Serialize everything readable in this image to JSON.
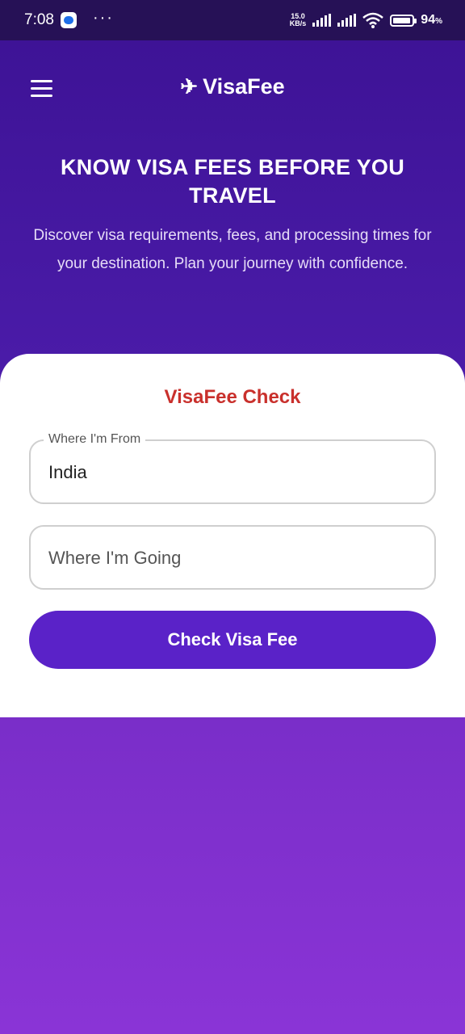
{
  "status_bar": {
    "time": "7:08",
    "more": "···",
    "net_speed_value": "15.0",
    "net_speed_unit": "KB/s",
    "battery_percent": "94",
    "battery_percent_sign": "%",
    "battery_level": 0.94
  },
  "appbar": {
    "brand_icon": "✈",
    "brand_name": "VisaFee"
  },
  "hero": {
    "title": "KNOW VISA FEES BEFORE YOU TRAVEL",
    "subtitle": "Discover visa requirements, fees, and processing times for your destination. Plan your journey with confidence."
  },
  "form": {
    "title": "VisaFee Check",
    "from_label": "Where I'm From",
    "from_value": "India",
    "to_placeholder": "Where I'm Going",
    "submit_label": "Check Visa Fee"
  },
  "colors": {
    "header_bg": "#3c1294",
    "accent_title": "#c9302c",
    "button": "#5a22c8"
  }
}
